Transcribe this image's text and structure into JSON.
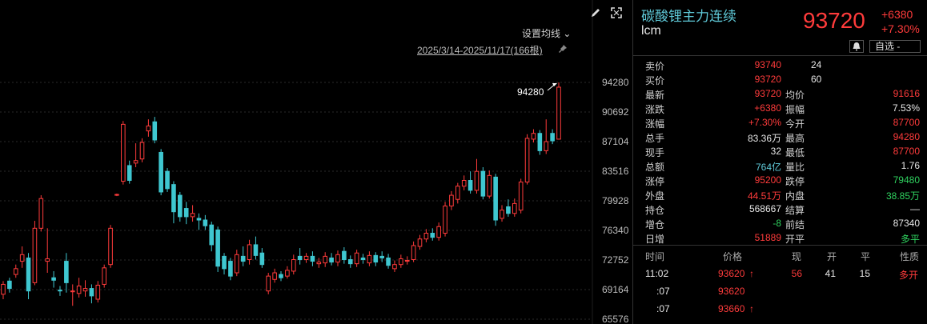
{
  "chart": {
    "ma_label": "设置均线",
    "date_range": "2025/3/14-2025/11/17(166根)",
    "high_marker": "94280",
    "y_ticks": [
      "94280",
      "90692",
      "87104",
      "83516",
      "79928",
      "76340",
      "72752",
      "69164",
      "65576"
    ]
  },
  "chart_data": {
    "type": "candlestick",
    "x_range": "2025/3/14-2025/11/17",
    "ylim": [
      65576,
      94280
    ],
    "y_ticks": [
      94280,
      90692,
      87104,
      83516,
      79928,
      76340,
      72752,
      69164,
      65576
    ],
    "annotations": [
      {
        "text": "94280",
        "value": 94280
      }
    ],
    "candles": [
      {
        "o": 68600,
        "c": 69800,
        "h": 70200,
        "l": 68000
      },
      {
        "o": 70200,
        "c": 69300,
        "h": 70600,
        "l": 68800
      },
      {
        "o": 71000,
        "c": 71700,
        "h": 72200,
        "l": 70600
      },
      {
        "o": 72600,
        "c": 73400,
        "h": 74400,
        "l": 71800
      },
      {
        "o": 73000,
        "c": 69000,
        "h": 73600,
        "l": 68000
      },
      {
        "o": 70000,
        "c": 76600,
        "h": 77500,
        "l": 69700
      },
      {
        "o": 76600,
        "c": 80200,
        "h": 80600,
        "l": 76200
      },
      {
        "o": 72600,
        "c": 72900,
        "h": 76600,
        "l": 71200
      },
      {
        "o": 70600,
        "c": 70300,
        "h": 71400,
        "l": 69400
      },
      {
        "o": 69100,
        "c": 69000,
        "h": 69600,
        "l": 68400
      },
      {
        "o": 72600,
        "c": 70000,
        "h": 73600,
        "l": 68800
      },
      {
        "o": 68900,
        "c": 69000,
        "h": 69800,
        "l": 67200
      },
      {
        "o": 68700,
        "c": 69600,
        "h": 70600,
        "l": 68200
      },
      {
        "o": 69000,
        "c": 69300,
        "h": 70300,
        "l": 68300
      },
      {
        "o": 69300,
        "c": 68400,
        "h": 69800,
        "l": 67500
      },
      {
        "o": 68000,
        "c": 69700,
        "h": 70200,
        "l": 67600
      },
      {
        "o": 69800,
        "c": 71800,
        "h": 72200,
        "l": 69400
      },
      {
        "o": 72200,
        "c": 76600,
        "h": 77000,
        "l": 71800
      },
      {
        "o": 80600,
        "c": 80700,
        "h": 80800,
        "l": 80500
      },
      {
        "o": 82300,
        "c": 89200,
        "h": 89600,
        "l": 81900
      },
      {
        "o": 84200,
        "c": 82400,
        "h": 84800,
        "l": 82000
      },
      {
        "o": 84500,
        "c": 84800,
        "h": 86900,
        "l": 84000
      },
      {
        "o": 85000,
        "c": 87000,
        "h": 87500,
        "l": 84600
      },
      {
        "o": 88400,
        "c": 89000,
        "h": 89800,
        "l": 87700
      },
      {
        "o": 89500,
        "c": 87300,
        "h": 90100,
        "l": 86900
      },
      {
        "o": 85800,
        "c": 81000,
        "h": 86200,
        "l": 80600
      },
      {
        "o": 83500,
        "c": 81400,
        "h": 83900,
        "l": 81000
      },
      {
        "o": 81900,
        "c": 78600,
        "h": 82300,
        "l": 77200
      },
      {
        "o": 80600,
        "c": 78000,
        "h": 81000,
        "l": 77400
      },
      {
        "o": 79000,
        "c": 78000,
        "h": 79800,
        "l": 77100
      },
      {
        "o": 78000,
        "c": 78400,
        "h": 79400,
        "l": 77400
      },
      {
        "o": 77800,
        "c": 77600,
        "h": 78400,
        "l": 76400
      },
      {
        "o": 77600,
        "c": 76900,
        "h": 78200,
        "l": 76400
      },
      {
        "o": 77000,
        "c": 74600,
        "h": 77400,
        "l": 73800
      },
      {
        "o": 76400,
        "c": 72000,
        "h": 76800,
        "l": 71300
      },
      {
        "o": 73200,
        "c": 71700,
        "h": 73600,
        "l": 71000
      },
      {
        "o": 72600,
        "c": 70800,
        "h": 73000,
        "l": 70300
      },
      {
        "o": 71200,
        "c": 73400,
        "h": 74000,
        "l": 70800
      },
      {
        "o": 73200,
        "c": 72600,
        "h": 74400,
        "l": 72000
      },
      {
        "o": 72800,
        "c": 74600,
        "h": 75200,
        "l": 72200
      },
      {
        "o": 74600,
        "c": 73300,
        "h": 75600,
        "l": 72800
      },
      {
        "o": 73600,
        "c": 72200,
        "h": 74200,
        "l": 71800
      },
      {
        "o": 69000,
        "c": 70800,
        "h": 71200,
        "l": 68600
      },
      {
        "o": 70400,
        "c": 71200,
        "h": 71700,
        "l": 70000
      },
      {
        "o": 71000,
        "c": 70600,
        "h": 71400,
        "l": 70200
      },
      {
        "o": 70800,
        "c": 71500,
        "h": 72000,
        "l": 70500
      },
      {
        "o": 71400,
        "c": 72800,
        "h": 73400,
        "l": 71000
      },
      {
        "o": 73200,
        "c": 72800,
        "h": 74200,
        "l": 72200
      },
      {
        "o": 72800,
        "c": 73200,
        "h": 73600,
        "l": 72400
      },
      {
        "o": 73200,
        "c": 72600,
        "h": 73800,
        "l": 72000
      },
      {
        "o": 72300,
        "c": 72500,
        "h": 73000,
        "l": 71800
      },
      {
        "o": 72400,
        "c": 73200,
        "h": 73700,
        "l": 71900
      },
      {
        "o": 73000,
        "c": 72500,
        "h": 73600,
        "l": 72100
      },
      {
        "o": 72500,
        "c": 73400,
        "h": 73900,
        "l": 72000
      },
      {
        "o": 73800,
        "c": 72800,
        "h": 74300,
        "l": 72300
      },
      {
        "o": 72800,
        "c": 72300,
        "h": 73300,
        "l": 71800
      },
      {
        "o": 72300,
        "c": 73600,
        "h": 74000,
        "l": 71900
      },
      {
        "o": 73000,
        "c": 72800,
        "h": 73500,
        "l": 72300
      },
      {
        "o": 72400,
        "c": 73300,
        "h": 73800,
        "l": 72000
      },
      {
        "o": 73300,
        "c": 72500,
        "h": 73700,
        "l": 72000
      },
      {
        "o": 73200,
        "c": 73000,
        "h": 73800,
        "l": 72500
      },
      {
        "o": 73000,
        "c": 72100,
        "h": 73500,
        "l": 71700
      },
      {
        "o": 71700,
        "c": 72200,
        "h": 72700,
        "l": 71300
      },
      {
        "o": 72200,
        "c": 72900,
        "h": 73400,
        "l": 71800
      },
      {
        "o": 72600,
        "c": 72700,
        "h": 73200,
        "l": 72200
      },
      {
        "o": 72800,
        "c": 74500,
        "h": 75000,
        "l": 72500
      },
      {
        "o": 74400,
        "c": 75300,
        "h": 75800,
        "l": 74000
      },
      {
        "o": 75300,
        "c": 76000,
        "h": 76500,
        "l": 74900
      },
      {
        "o": 76000,
        "c": 75500,
        "h": 76600,
        "l": 75100
      },
      {
        "o": 75500,
        "c": 76800,
        "h": 77300,
        "l": 75100
      },
      {
        "o": 76000,
        "c": 79300,
        "h": 79800,
        "l": 75600
      },
      {
        "o": 79300,
        "c": 80600,
        "h": 81100,
        "l": 78800
      },
      {
        "o": 80100,
        "c": 81700,
        "h": 82100,
        "l": 79600
      },
      {
        "o": 81700,
        "c": 82400,
        "h": 83000,
        "l": 81200
      },
      {
        "o": 82400,
        "c": 81200,
        "h": 83500,
        "l": 80800
      },
      {
        "o": 81200,
        "c": 83500,
        "h": 85000,
        "l": 80800
      },
      {
        "o": 83500,
        "c": 80500,
        "h": 84000,
        "l": 80100
      },
      {
        "o": 80500,
        "c": 83000,
        "h": 83600,
        "l": 80200
      },
      {
        "o": 82800,
        "c": 77600,
        "h": 83200,
        "l": 76900
      },
      {
        "o": 77800,
        "c": 78800,
        "h": 79400,
        "l": 77400
      },
      {
        "o": 79200,
        "c": 78400,
        "h": 80100,
        "l": 78000
      },
      {
        "o": 78400,
        "c": 79600,
        "h": 80200,
        "l": 78000
      },
      {
        "o": 78800,
        "c": 82200,
        "h": 82600,
        "l": 78400
      },
      {
        "o": 82200,
        "c": 87500,
        "h": 88000,
        "l": 81900
      },
      {
        "o": 87400,
        "c": 88100,
        "h": 88600,
        "l": 87000
      },
      {
        "o": 88100,
        "c": 86000,
        "h": 88500,
        "l": 85500
      },
      {
        "o": 86000,
        "c": 87100,
        "h": 89800,
        "l": 85600
      },
      {
        "o": 88100,
        "c": 87200,
        "h": 88600,
        "l": 86800
      },
      {
        "o": 87400,
        "c": 93700,
        "h": 94280,
        "l": 87400
      }
    ]
  },
  "quote": {
    "name": "碳酸锂主力连续",
    "code": "lcm",
    "price": "93720",
    "change": "+6380",
    "change_pct": "+7.30%",
    "selector": "自选 -",
    "rows": [
      {
        "l1": "卖价",
        "v1": "93740",
        "c1": "red",
        "l2": "",
        "v2": "24",
        "c2": "white",
        "v2left": true
      },
      {
        "l1": "买价",
        "v1": "93720",
        "c1": "red",
        "l2": "",
        "v2": "60",
        "c2": "white",
        "v2left": true
      },
      {
        "l1": "最新",
        "v1": "93720",
        "c1": "red",
        "l2": "均价",
        "v2": "91616",
        "c2": "red"
      },
      {
        "l1": "涨跌",
        "v1": "+6380",
        "c1": "red",
        "l2": "振幅",
        "v2": "7.53%",
        "c2": "white"
      },
      {
        "l1": "涨幅",
        "v1": "+7.30%",
        "c1": "red",
        "l2": "今开",
        "v2": "87700",
        "c2": "red"
      },
      {
        "l1": "总手",
        "v1": "83.36万",
        "c1": "white",
        "l2": "最高",
        "v2": "94280",
        "c2": "red"
      },
      {
        "l1": "现手",
        "v1": "32",
        "c1": "white",
        "l2": "最低",
        "v2": "87700",
        "c2": "red"
      },
      {
        "l1": "总额",
        "v1": "764亿",
        "c1": "cyan",
        "l2": "量比",
        "v2": "1.76",
        "c2": "white"
      },
      {
        "l1": "涨停",
        "v1": "95200",
        "c1": "red",
        "l2": "跌停",
        "v2": "79480",
        "c2": "green"
      },
      {
        "l1": "外盘",
        "v1": "44.51万",
        "c1": "red",
        "l2": "内盘",
        "v2": "38.85万",
        "c2": "green"
      },
      {
        "l1": "持仓",
        "v1": "568667",
        "c1": "white",
        "l2": "结算",
        "v2": "—",
        "c2": "white"
      },
      {
        "l1": "增仓",
        "v1": "-8",
        "c1": "green",
        "l2": "前结",
        "v2": "87340",
        "c2": "white"
      },
      {
        "l1": "日增",
        "v1": "51889",
        "c1": "red",
        "l2": "开平",
        "v2": "多平",
        "c2": "green"
      }
    ],
    "tick_headers": [
      "时间",
      "价格",
      "现",
      "开",
      "平",
      "性质"
    ],
    "ticks": [
      {
        "time": "11:02",
        "price": "93620",
        "arrow": "↑",
        "vol": "56",
        "open": "41",
        "close": "15",
        "nature": "多开"
      },
      {
        "time": ":07",
        "price": "93620",
        "arrow": "",
        "vol": "",
        "open": "",
        "close": "",
        "nature": ""
      },
      {
        "time": ":07",
        "price": "93660",
        "arrow": "↑",
        "vol": "",
        "open": "",
        "close": "",
        "nature": ""
      }
    ]
  },
  "colors": {
    "up": "#ff3b3b",
    "down": "#3fc7d0",
    "grid": "#2a2a2a",
    "accent": "#5fc9d8"
  }
}
